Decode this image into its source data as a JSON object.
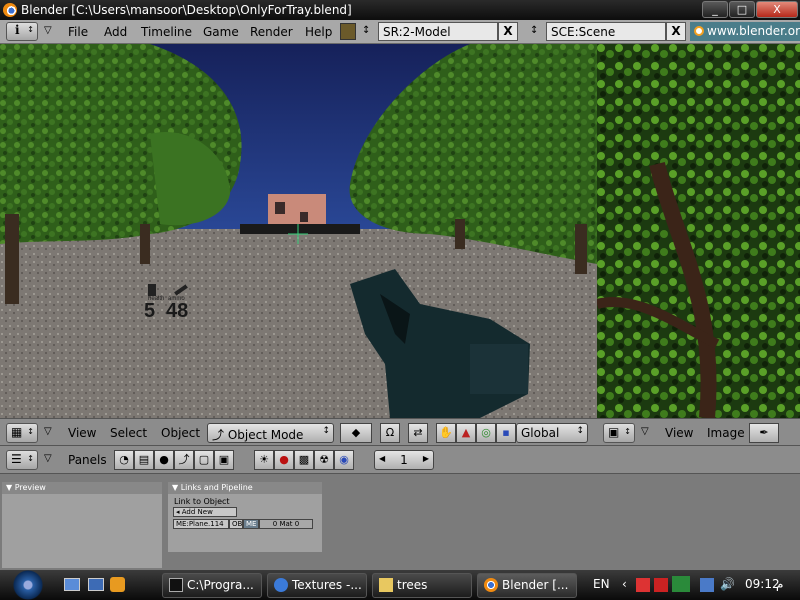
{
  "window": {
    "title": "Blender [C:\\Users\\mansoor\\Desktop\\OnlyForTray.blend]",
    "minimize": "_",
    "maximize": "□",
    "close": "X"
  },
  "header": {
    "menus": [
      "File",
      "Add",
      "Timeline",
      "Game",
      "Render",
      "Help"
    ],
    "screen": "SR:2-Model",
    "scene": "SCE:Scene",
    "clear": "X",
    "url": "www.blender.org"
  },
  "hud": {
    "health_label": "health",
    "health": "5",
    "ammo_label": "ammo",
    "ammo": "48"
  },
  "view3d_header": {
    "menus": [
      "View",
      "Select",
      "Object"
    ],
    "mode": "Object Mode",
    "orientation": "Global"
  },
  "image_header": {
    "menus": [
      "View",
      "Image"
    ]
  },
  "buttons_header": {
    "panels_label": "Panels",
    "frame": "1"
  },
  "panels": {
    "preview_title": "Preview",
    "links_title": "Links and Pipeline",
    "link_to_object": "Link to Object",
    "add_new": "Add New",
    "mesh_name": "ME:Plane.114",
    "ob_btn": "OB",
    "me_btn": "ME",
    "mat_count": "0 Mat 0"
  },
  "taskbar": {
    "tasks": [
      "C:\\Progra...",
      "Textures -...",
      "trees",
      "Blender [..."
    ],
    "language": "EN",
    "time": "09:12",
    "ampm": "م"
  },
  "colors": {
    "blender_gray": "#a8a8a8",
    "sky": "#1e2f72",
    "foliage": "#3a6e1e"
  }
}
